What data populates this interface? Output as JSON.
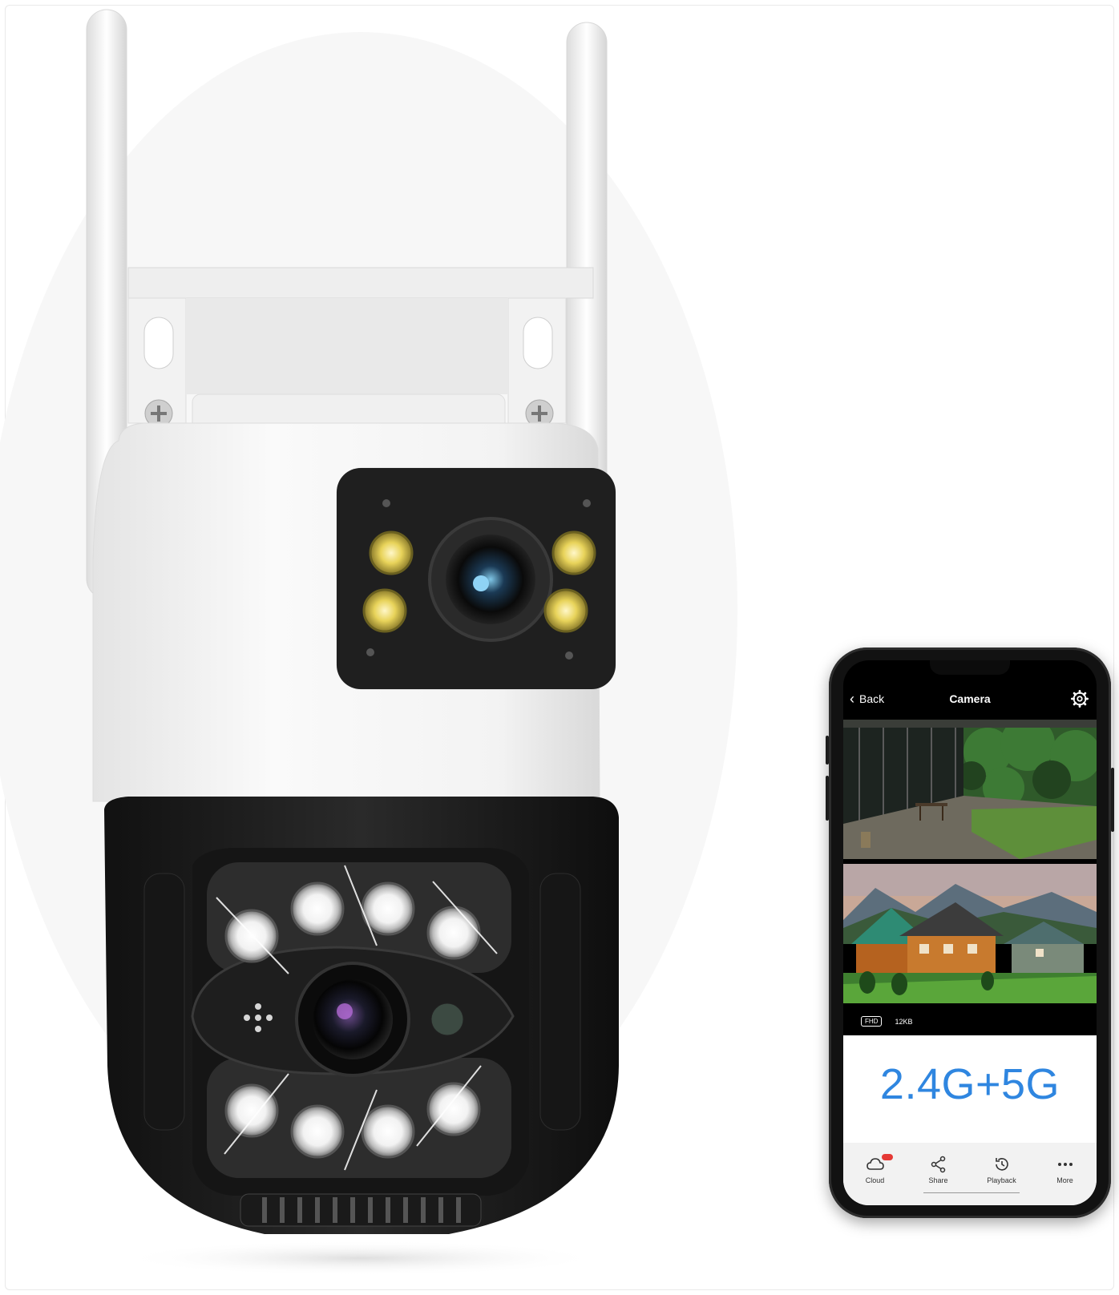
{
  "colors": {
    "accent_blue": "#2f86e0",
    "camera_white": "#f1f1f1",
    "camera_black": "#1b1b1b",
    "led_yellow": "#e8d35a",
    "badge_red": "#e53935"
  },
  "app": {
    "back_label": "Back",
    "title": "Camera",
    "settings_icon": "gear-icon"
  },
  "stream": {
    "quality": "FHD",
    "bitrate": "12KB"
  },
  "feature_text": "2.4G+5G",
  "tabs": [
    {
      "label": "Cloud",
      "icon": "cloud-icon"
    },
    {
      "label": "Share",
      "icon": "share-icon"
    },
    {
      "label": "Playback",
      "icon": "history-icon"
    },
    {
      "label": "More",
      "icon": "more-icon"
    }
  ],
  "cloud_badge": ""
}
